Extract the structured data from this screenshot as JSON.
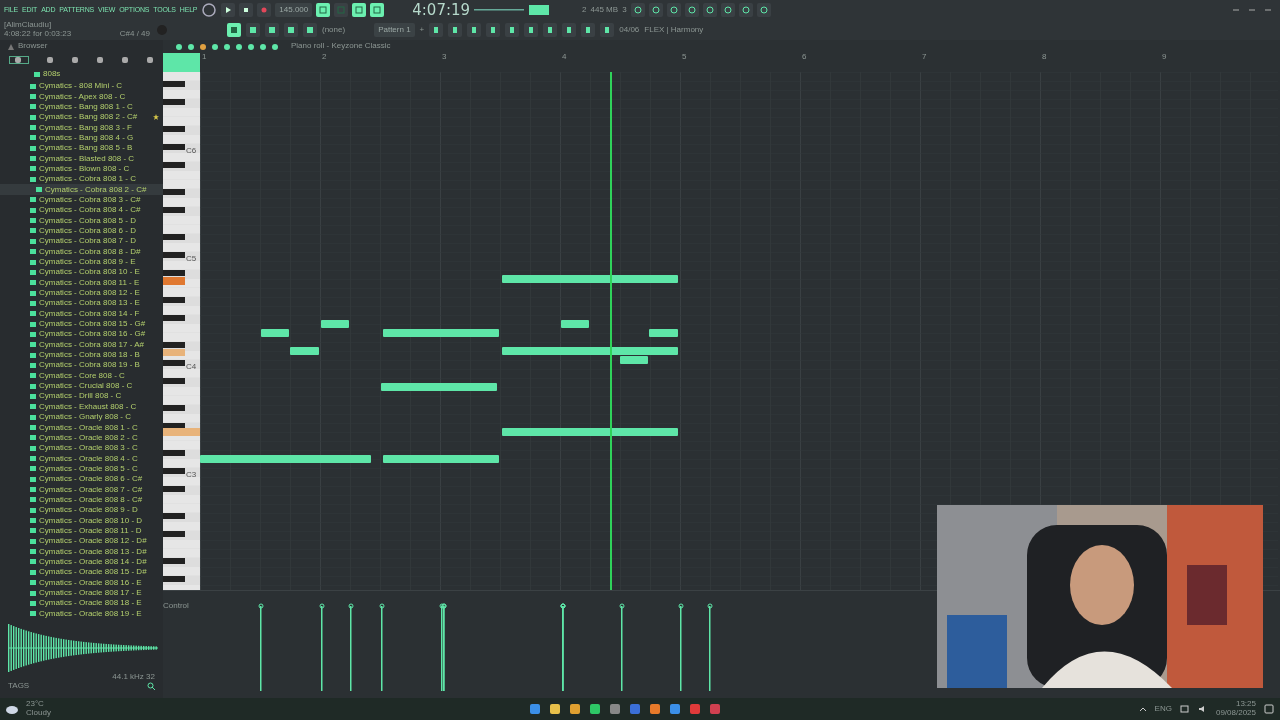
{
  "menu": [
    "FILE",
    "EDIT",
    "ADD",
    "PATTERNS",
    "VIEW",
    "OPTIONS",
    "TOOLS",
    "HELP"
  ],
  "transport": {
    "tempo": "145.000",
    "time": "4:07:19",
    "memory": "445 MB",
    "cpu_a": "2",
    "cpu_b": "3"
  },
  "hint": {
    "user": "[AlimClaudiu]",
    "position": "4:08:22 for 0:03:23",
    "note": "C#4 / 49"
  },
  "toolbar": {
    "snap": "(none)",
    "pattern": "Pattern 1",
    "pattern_add": "+",
    "news_count": "04/06",
    "news": "FLEX | Harmony"
  },
  "browser": {
    "title": "Browser",
    "folder": "808s",
    "items": [
      {
        "name": "Cymatics - 808 Mini - C",
        "selected": false,
        "favorite": false
      },
      {
        "name": "Cymatics - Apex 808 - C",
        "selected": false,
        "favorite": false
      },
      {
        "name": "Cymatics - Bang 808 1 - C",
        "selected": false,
        "favorite": false
      },
      {
        "name": "Cymatics - Bang 808 2 - C#",
        "selected": false,
        "favorite": true
      },
      {
        "name": "Cymatics - Bang 808 3 - F",
        "selected": false,
        "favorite": false
      },
      {
        "name": "Cymatics - Bang 808 4 - G",
        "selected": false,
        "favorite": false
      },
      {
        "name": "Cymatics - Bang 808 5 - B",
        "selected": false,
        "favorite": false
      },
      {
        "name": "Cymatics - Blasted 808 - C",
        "selected": false,
        "favorite": false
      },
      {
        "name": "Cymatics - Blown 808 - C",
        "selected": false,
        "favorite": false
      },
      {
        "name": "Cymatics - Cobra 808 1 - C",
        "selected": false,
        "favorite": false
      },
      {
        "name": "Cymatics - Cobra 808 2 - C#",
        "selected": true,
        "favorite": false
      },
      {
        "name": "Cymatics - Cobra 808 3 - C#",
        "selected": false,
        "favorite": false
      },
      {
        "name": "Cymatics - Cobra 808 4 - C#",
        "selected": false,
        "favorite": false
      },
      {
        "name": "Cymatics - Cobra 808 5 - D",
        "selected": false,
        "favorite": false
      },
      {
        "name": "Cymatics - Cobra 808 6 - D",
        "selected": false,
        "favorite": false
      },
      {
        "name": "Cymatics - Cobra 808 7 - D",
        "selected": false,
        "favorite": false
      },
      {
        "name": "Cymatics - Cobra 808 8 - D#",
        "selected": false,
        "favorite": false
      },
      {
        "name": "Cymatics - Cobra 808 9 - E",
        "selected": false,
        "favorite": false
      },
      {
        "name": "Cymatics - Cobra 808 10 - E",
        "selected": false,
        "favorite": false
      },
      {
        "name": "Cymatics - Cobra 808 11 - E",
        "selected": false,
        "favorite": false
      },
      {
        "name": "Cymatics - Cobra 808 12 - E",
        "selected": false,
        "favorite": false
      },
      {
        "name": "Cymatics - Cobra 808 13 - E",
        "selected": false,
        "favorite": false
      },
      {
        "name": "Cymatics - Cobra 808 14 - F",
        "selected": false,
        "favorite": false
      },
      {
        "name": "Cymatics - Cobra 808 15 - G#",
        "selected": false,
        "favorite": false
      },
      {
        "name": "Cymatics - Cobra 808 16 - G#",
        "selected": false,
        "favorite": false
      },
      {
        "name": "Cymatics - Cobra 808 17 - A#",
        "selected": false,
        "favorite": false
      },
      {
        "name": "Cymatics - Cobra 808 18 - B",
        "selected": false,
        "favorite": false
      },
      {
        "name": "Cymatics - Cobra 808 19 - B",
        "selected": false,
        "favorite": false
      },
      {
        "name": "Cymatics - Core 808 - C",
        "selected": false,
        "favorite": false
      },
      {
        "name": "Cymatics - Crucial 808 - C",
        "selected": false,
        "favorite": false
      },
      {
        "name": "Cymatics - Drill 808 - C",
        "selected": false,
        "favorite": false
      },
      {
        "name": "Cymatics - Exhaust 808 - C",
        "selected": false,
        "favorite": false
      },
      {
        "name": "Cymatics - Gnarly 808 - C",
        "selected": false,
        "favorite": false
      },
      {
        "name": "Cymatics - Oracle 808 1 - C",
        "selected": false,
        "favorite": false
      },
      {
        "name": "Cymatics - Oracle 808 2 - C",
        "selected": false,
        "favorite": false
      },
      {
        "name": "Cymatics - Oracle 808 3 - C",
        "selected": false,
        "favorite": false
      },
      {
        "name": "Cymatics - Oracle 808 4 - C",
        "selected": false,
        "favorite": false
      },
      {
        "name": "Cymatics - Oracle 808 5 - C",
        "selected": false,
        "favorite": false
      },
      {
        "name": "Cymatics - Oracle 808 6 - C#",
        "selected": false,
        "favorite": false
      },
      {
        "name": "Cymatics - Oracle 808 7 - C#",
        "selected": false,
        "favorite": false
      },
      {
        "name": "Cymatics - Oracle 808 8 - C#",
        "selected": false,
        "favorite": false
      },
      {
        "name": "Cymatics - Oracle 808 9 - D",
        "selected": false,
        "favorite": false
      },
      {
        "name": "Cymatics - Oracle 808 10 - D",
        "selected": false,
        "favorite": false
      },
      {
        "name": "Cymatics - Oracle 808 11 - D",
        "selected": false,
        "favorite": false
      },
      {
        "name": "Cymatics - Oracle 808 12 - D#",
        "selected": false,
        "favorite": false
      },
      {
        "name": "Cymatics - Oracle 808 13 - D#",
        "selected": false,
        "favorite": false
      },
      {
        "name": "Cymatics - Oracle 808 14 - D#",
        "selected": false,
        "favorite": false
      },
      {
        "name": "Cymatics - Oracle 808 15 - D#",
        "selected": false,
        "favorite": false
      },
      {
        "name": "Cymatics - Oracle 808 16 - E",
        "selected": false,
        "favorite": false
      },
      {
        "name": "Cymatics - Oracle 808 17 - E",
        "selected": false,
        "favorite": false
      },
      {
        "name": "Cymatics - Oracle 808 18 - E",
        "selected": false,
        "favorite": false
      },
      {
        "name": "Cymatics - Oracle 808 19 - E",
        "selected": false,
        "favorite": false
      }
    ],
    "sample_info": "44.1 kHz 32",
    "tags": "TAGS"
  },
  "piano_roll": {
    "title": "Piano roll - Keyzone Classic",
    "bars": [
      "1",
      "2",
      "3",
      "4",
      "5",
      "6",
      "7",
      "8",
      "9"
    ],
    "octaves": [
      "C6",
      "C5",
      "C4",
      "C3"
    ],
    "event_lane": "Control"
  },
  "webcam": {
    "kind": "picture"
  },
  "taskbar": {
    "temperature": "23°C",
    "weather": "Cloudy",
    "language": "ENG",
    "time": "13:25",
    "date": "09/08/2025"
  }
}
